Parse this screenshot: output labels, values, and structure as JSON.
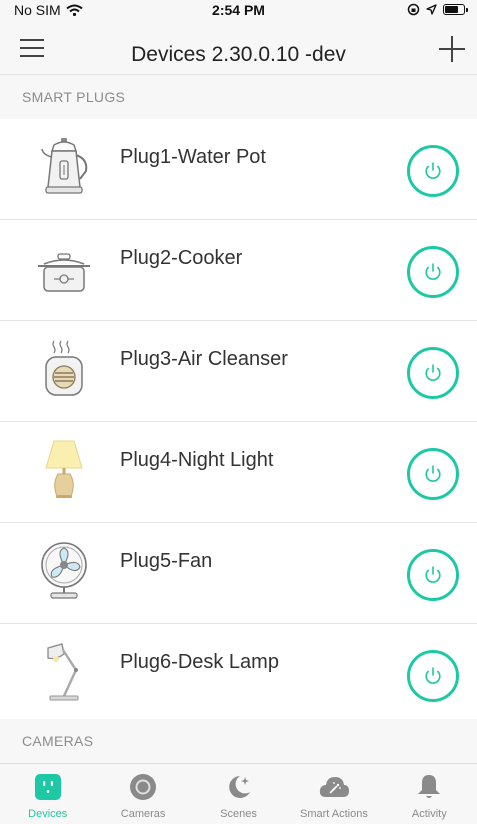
{
  "status_bar": {
    "carrier": "No SIM",
    "time": "2:54 PM",
    "battery_level": 0.75
  },
  "nav": {
    "title": "Devices 2.30.0.10 -dev"
  },
  "sections": {
    "plugs_label": "SMART PLUGS",
    "cameras_label": "CAMERAS"
  },
  "devices": [
    {
      "name": "Plug1-Water Pot",
      "icon": "kettle-icon",
      "power": "off"
    },
    {
      "name": "Plug2-Cooker",
      "icon": "cooker-icon",
      "power": "off"
    },
    {
      "name": "Plug3-Air Cleanser",
      "icon": "air-cleanser-icon",
      "power": "off"
    },
    {
      "name": "Plug4-Night Light",
      "icon": "night-light-icon",
      "power": "off"
    },
    {
      "name": "Plug5-Fan",
      "icon": "fan-icon",
      "power": "off"
    },
    {
      "name": "Plug6-Desk Lamp",
      "icon": "desk-lamp-icon",
      "power": "off"
    }
  ],
  "tabs": [
    {
      "label": "Devices",
      "icon": "plug-icon",
      "active": true
    },
    {
      "label": "Cameras",
      "icon": "camera-icon",
      "active": false
    },
    {
      "label": "Scenes",
      "icon": "moon-icon",
      "active": false
    },
    {
      "label": "Smart Actions",
      "icon": "cloud-icon",
      "active": false
    },
    {
      "label": "Activity",
      "icon": "bell-icon",
      "active": false
    }
  ],
  "colors": {
    "accent": "#1cc9a4",
    "header_bg": "#f7f7f7",
    "divider": "#e4e4e4",
    "tab_inactive": "#8a8a8a"
  }
}
